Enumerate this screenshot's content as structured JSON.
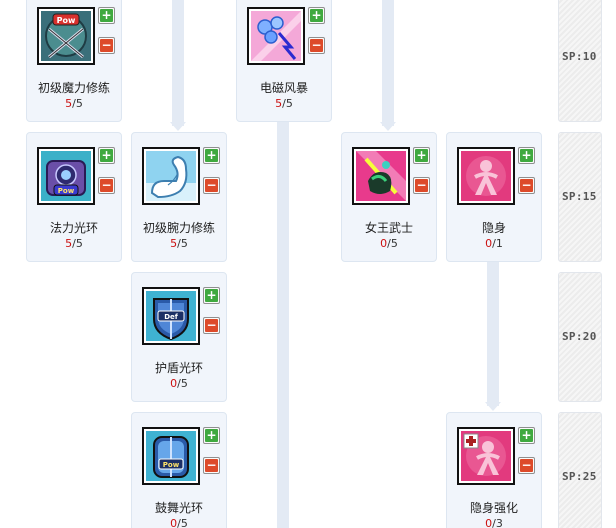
{
  "skills": [
    {
      "name": "初级魔力修练",
      "cur": "5",
      "max": "5",
      "icon": "pow-crossed-staves-icon"
    },
    {
      "name": "电磁风暴",
      "cur": "5",
      "max": "5",
      "icon": "electro-storm-icon"
    },
    {
      "name": "法力光环",
      "cur": "5",
      "max": "5",
      "icon": "mana-aura-pow-icon"
    },
    {
      "name": "初级腕力修练",
      "cur": "5",
      "max": "5",
      "icon": "flexed-arm-icon"
    },
    {
      "name": "女王武士",
      "cur": "0",
      "max": "5",
      "icon": "queen-warrior-icon"
    },
    {
      "name": "隐身",
      "cur": "0",
      "max": "1",
      "icon": "stealth-ribbon-icon"
    },
    {
      "name": "护盾光环",
      "cur": "0",
      "max": "5",
      "icon": "shield-def-icon"
    },
    {
      "name": "鼓舞光环",
      "cur": "0",
      "max": "5",
      "icon": "inspire-pow-icon"
    },
    {
      "name": "隐身强化",
      "cur": "0",
      "max": "3",
      "icon": "enhanced-stealth-icon"
    }
  ],
  "buttons": {
    "plus": "+",
    "minus": "−"
  },
  "sp_tiers": [
    "SP:10",
    "SP:15",
    "SP:20",
    "SP:25"
  ],
  "colors": {
    "current_level": "#cc1111",
    "plus_button": "#3fa93f",
    "minus_button": "#dd4a2a",
    "card_bg": "#f1f5fb"
  }
}
